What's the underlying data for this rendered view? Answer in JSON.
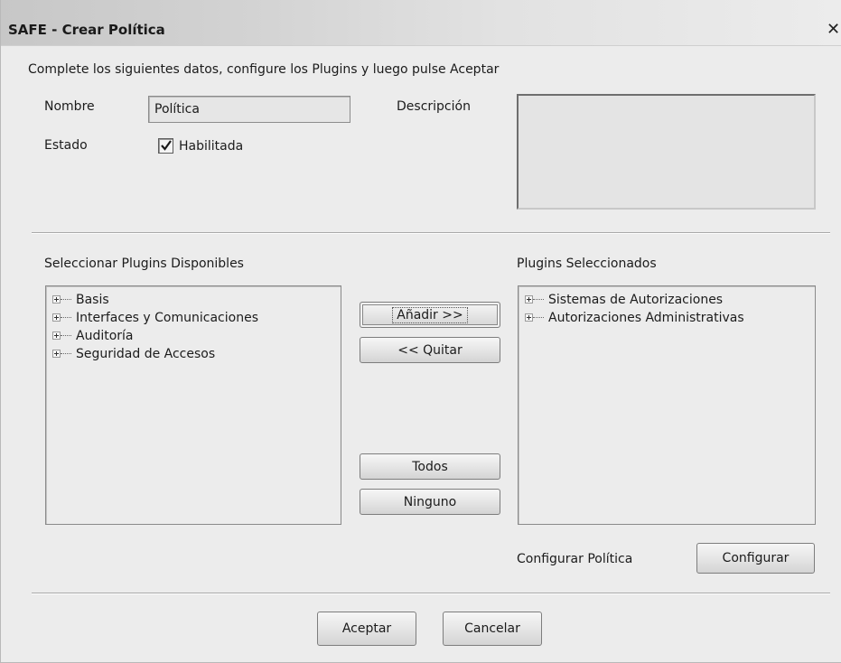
{
  "window": {
    "title": "SAFE - Crear Política",
    "close_glyph": "✕"
  },
  "instructions": "Complete los siguientes datos, configure los Plugins y luego pulse Aceptar",
  "form": {
    "nombre_label": "Nombre",
    "nombre_value": "Política",
    "descripcion_label": "Descripción",
    "descripcion_value": "",
    "estado_label": "Estado",
    "habilitada_label": "Habilitada",
    "habilitada_checked": true
  },
  "available": {
    "label": "Seleccionar Plugins Disponibles",
    "items": [
      {
        "label": "Basis"
      },
      {
        "label": "Interfaces y Comunicaciones"
      },
      {
        "label": "Auditoría"
      },
      {
        "label": "Seguridad de Accesos"
      }
    ]
  },
  "selected": {
    "label": "Plugins Seleccionados",
    "items": [
      {
        "label": "Sistemas de Autorizaciones"
      },
      {
        "label": "Autorizaciones Administrativas"
      }
    ]
  },
  "buttons": {
    "add": "Añadir >>",
    "remove": "<< Quitar",
    "all": "Todos",
    "none": "Ninguno",
    "configure": "Configurar",
    "accept": "Aceptar",
    "cancel": "Cancelar"
  },
  "configure_label": "Configurar Política",
  "icons": {
    "close": "close-icon",
    "check": "checkmark-icon",
    "expand": "expand-plus-icon"
  }
}
